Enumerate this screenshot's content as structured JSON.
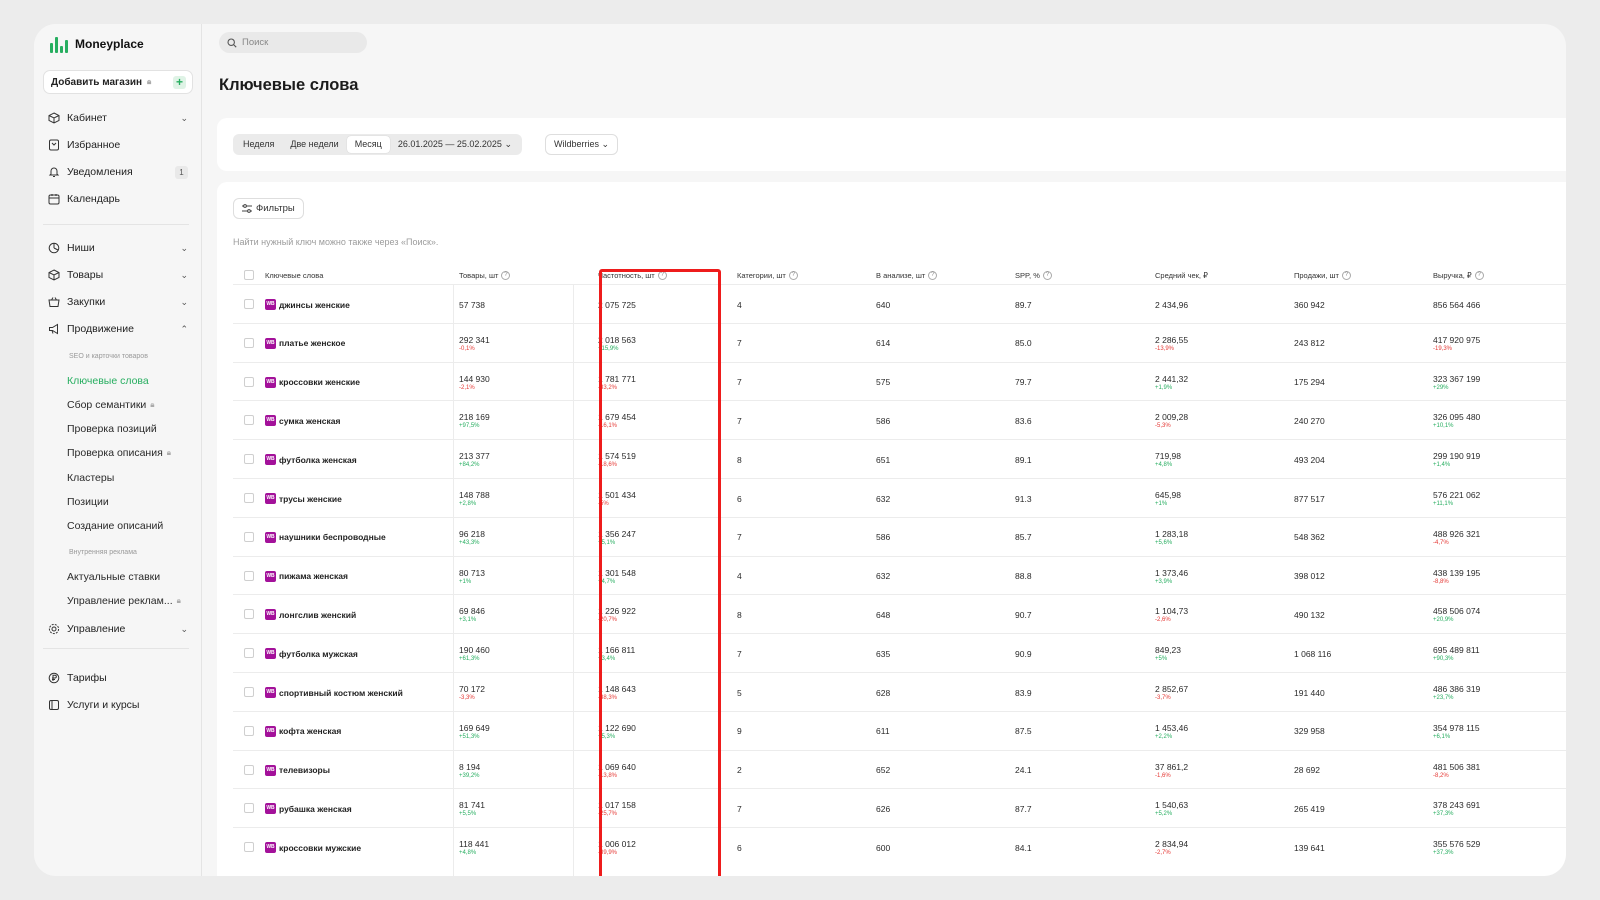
{
  "sidebar": {
    "brand": "Moneyplace",
    "add_shop": "Добавить магазин",
    "group1": [
      {
        "label": "Кабинет",
        "icon": "cube-icon",
        "chevron": true
      },
      {
        "label": "Избранное",
        "icon": "bookmark-icon"
      },
      {
        "label": "Уведомления",
        "icon": "bell-icon",
        "badge": "1"
      },
      {
        "label": "Календарь",
        "icon": "calendar-icon"
      }
    ],
    "group2": [
      {
        "label": "Ниши",
        "icon": "pie-icon",
        "chevron": true
      },
      {
        "label": "Товары",
        "icon": "box-icon",
        "chevron": true
      },
      {
        "label": "Закупки",
        "icon": "basket-icon",
        "chevron": true
      },
      {
        "label": "Продвижение",
        "icon": "megaphone-icon",
        "chevron": true
      }
    ],
    "promo_caption_seo": "SEO и карточки товаров",
    "promo_items_seo": [
      "Ключевые слова",
      "Сбор семантики",
      "Проверка позиций",
      "Проверка описания",
      "Кластеры",
      "Позиции",
      "Создание описаний"
    ],
    "promo_caption_ads": "Внутренняя реклама",
    "promo_items_ads": [
      "Актуальные ставки",
      "Управление реклам..."
    ],
    "management": "Управление",
    "group3": [
      {
        "label": "Тарифы",
        "icon": "ruble-icon"
      },
      {
        "label": "Услуги и курсы",
        "icon": "book-icon"
      }
    ]
  },
  "search": {
    "placeholder": "Поиск"
  },
  "page": {
    "title": "Ключевые слова"
  },
  "periods": {
    "week": "Неделя",
    "two_weeks": "Две недели",
    "month": "Месяц",
    "date_range": "26.01.2025 — 25.02.2025"
  },
  "marketplace": "Wildberries",
  "filters_label": "Фильтры",
  "hint": "Найти нужный ключ можно также через «Поиск».",
  "table": {
    "columns": [
      "Ключевые слова",
      "Товары, шт",
      "Частотность, шт",
      "Категории, шт",
      "В анализе, шт",
      "SPP, %",
      "Средний чек, ₽",
      "Продажи, шт",
      "Выручка, ₽"
    ],
    "rows": [
      {
        "kw": "джинсы женские",
        "goods": "57 738",
        "goods_d": "",
        "freq": "2 075 725",
        "freq_d": "",
        "cat": "4",
        "anal": "640",
        "spp": "89.7",
        "check": "2 434,96",
        "check_d": "",
        "sales": "360 942",
        "rev": "856 564 466",
        "rev_d": ""
      },
      {
        "kw": "платье женское",
        "goods": "292 341",
        "goods_d": "-0,1%",
        "freq": "2 018 563",
        "freq_d": "+15,9%",
        "cat": "7",
        "anal": "614",
        "spp": "85.0",
        "check": "2 286,55",
        "check_d": "-13,9%",
        "sales": "243 812",
        "rev": "417 920 975",
        "rev_d": "-19,3%"
      },
      {
        "kw": "кроссовки женские",
        "goods": "144 930",
        "goods_d": "-2,1%",
        "freq": "1 781 771",
        "freq_d": "-33,2%",
        "cat": "7",
        "anal": "575",
        "spp": "79.7",
        "check": "2 441,32",
        "check_d": "+1,9%",
        "sales": "175 294",
        "rev": "323 367 199",
        "rev_d": "+29%"
      },
      {
        "kw": "сумка женская",
        "goods": "218 169",
        "goods_d": "+97,5%",
        "freq": "1 679 454",
        "freq_d": "-16,1%",
        "cat": "7",
        "anal": "586",
        "spp": "83.6",
        "check": "2 009,28",
        "check_d": "-5,3%",
        "sales": "240 270",
        "rev": "326 095 480",
        "rev_d": "+10,1%"
      },
      {
        "kw": "футболка женская",
        "goods": "213 377",
        "goods_d": "+84,2%",
        "freq": "1 574 519",
        "freq_d": "-18,6%",
        "cat": "8",
        "anal": "651",
        "spp": "89.1",
        "check": "719,98",
        "check_d": "+4,8%",
        "sales": "493 204",
        "rev": "299 190 919",
        "rev_d": "+1,4%"
      },
      {
        "kw": "трусы женские",
        "goods": "148 788",
        "goods_d": "+2,8%",
        "freq": "1 501 434",
        "freq_d": "-5%",
        "cat": "6",
        "anal": "632",
        "spp": "91.3",
        "check": "645,98",
        "check_d": "+1%",
        "sales": "877 517",
        "rev": "576 221 062",
        "rev_d": "+11,1%"
      },
      {
        "kw": "наушники беспроводные",
        "goods": "96 218",
        "goods_d": "+43,3%",
        "freq": "1 356 247",
        "freq_d": "+5,1%",
        "cat": "7",
        "anal": "586",
        "spp": "85.7",
        "check": "1 283,18",
        "check_d": "+5,6%",
        "sales": "548 362",
        "rev": "488 926 321",
        "rev_d": "-4,7%"
      },
      {
        "kw": "пижама женская",
        "goods": "80 713",
        "goods_d": "+1%",
        "freq": "1 301 548",
        "freq_d": "+4,7%",
        "cat": "4",
        "anal": "632",
        "spp": "88.8",
        "check": "1 373,46",
        "check_d": "+3,9%",
        "sales": "398 012",
        "rev": "438 139 195",
        "rev_d": "-8,8%"
      },
      {
        "kw": "лонгслив женский",
        "goods": "69 846",
        "goods_d": "+3,1%",
        "freq": "1 226 922",
        "freq_d": "-20,7%",
        "cat": "8",
        "anal": "648",
        "spp": "90.7",
        "check": "1 104,73",
        "check_d": "-2,6%",
        "sales": "490 132",
        "rev": "458 506 074",
        "rev_d": "+20,9%"
      },
      {
        "kw": "футболка мужская",
        "goods": "190 460",
        "goods_d": "+61,3%",
        "freq": "1 166 811",
        "freq_d": "+3,4%",
        "cat": "7",
        "anal": "635",
        "spp": "90.9",
        "check": "849,23",
        "check_d": "+5%",
        "sales": "1 068 116",
        "rev": "695 489 811",
        "rev_d": "+90,3%"
      },
      {
        "kw": "спортивный костюм женский",
        "goods": "70 172",
        "goods_d": "-3,3%",
        "freq": "1 148 643",
        "freq_d": "-38,3%",
        "cat": "5",
        "anal": "628",
        "spp": "83.9",
        "check": "2 852,67",
        "check_d": "-3,7%",
        "sales": "191 440",
        "rev": "486 386 319",
        "rev_d": "+23,7%"
      },
      {
        "kw": "кофта женская",
        "goods": "169 649",
        "goods_d": "+51,3%",
        "freq": "1 122 690",
        "freq_d": "+5,3%",
        "cat": "9",
        "anal": "611",
        "spp": "87.5",
        "check": "1 453,46",
        "check_d": "+2,2%",
        "sales": "329 958",
        "rev": "354 978 115",
        "rev_d": "+6,1%"
      },
      {
        "kw": "телевизоры",
        "goods": "8 194",
        "goods_d": "+39,2%",
        "freq": "1 069 640",
        "freq_d": "-13,8%",
        "cat": "2",
        "anal": "652",
        "spp": "24.1",
        "check": "37 861,2",
        "check_d": "-1,6%",
        "sales": "28 692",
        "rev": "481 506 381",
        "rev_d": "-8,2%"
      },
      {
        "kw": "рубашка женская",
        "goods": "81 741",
        "goods_d": "+5,5%",
        "freq": "1 017 158",
        "freq_d": "-25,7%",
        "cat": "7",
        "anal": "626",
        "spp": "87.7",
        "check": "1 540,63",
        "check_d": "+5,2%",
        "sales": "265 419",
        "rev": "378 243 691",
        "rev_d": "+37,3%"
      },
      {
        "kw": "кроссовки мужские",
        "goods": "118 441",
        "goods_d": "+4,8%",
        "freq": "1 006 012",
        "freq_d": "-39,9%",
        "cat": "6",
        "anal": "600",
        "spp": "84.1",
        "check": "2 834,94",
        "check_d": "-2,7%",
        "sales": "139 641",
        "rev": "355 576 529",
        "rev_d": "+37,3%"
      }
    ]
  },
  "marketplace_badge": "WB",
  "accent_color": "#27ae60",
  "highlight_color": "#ee1c1c"
}
